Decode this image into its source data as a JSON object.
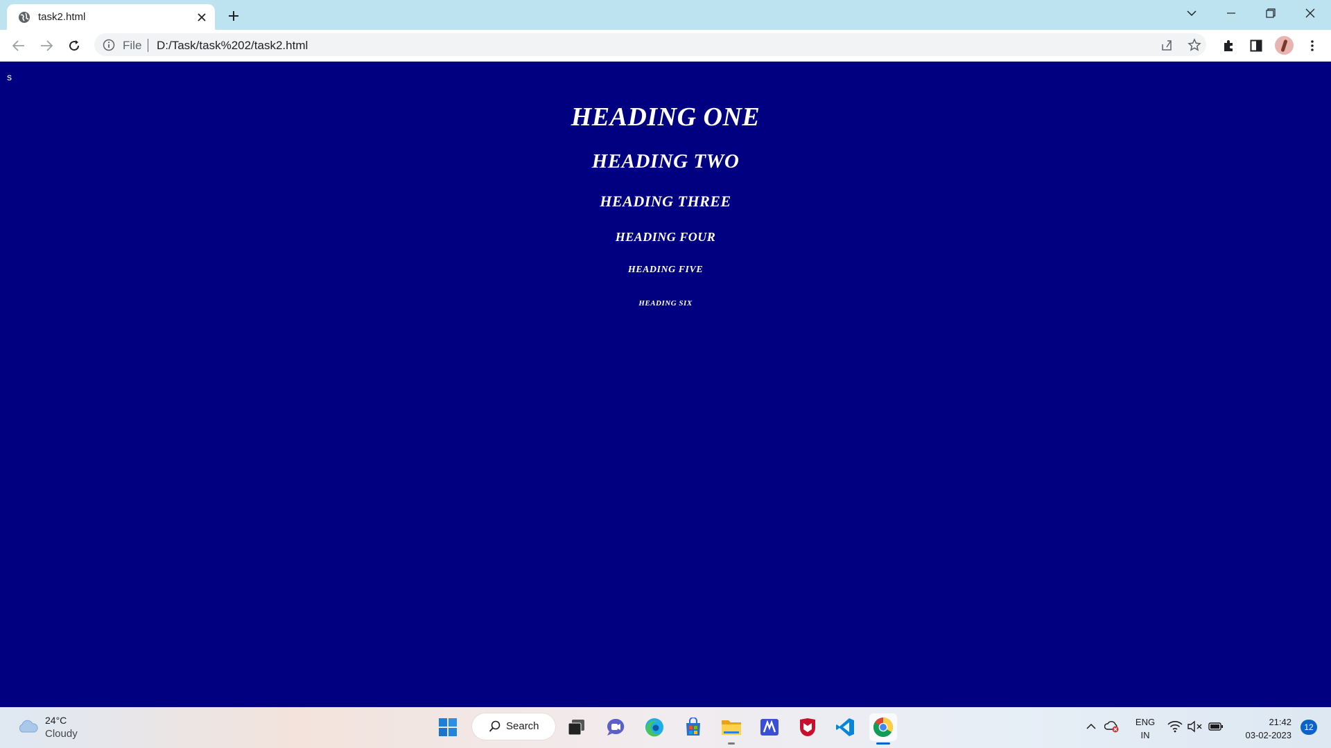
{
  "browser": {
    "tab_title": "task2.html",
    "scheme_label": "File",
    "url": "D:/Task/task%202/task2.html"
  },
  "page": {
    "stray_text": "s",
    "headings": {
      "h1": "HEADING ONE",
      "h2": "HEADING TWO",
      "h3": "HEADING THREE",
      "h4": "HEADING FOUR",
      "h5": "HEADING FIVE",
      "h6": "HEADING SIX"
    },
    "background_color": "#000080",
    "text_color": "#ffffff"
  },
  "taskbar": {
    "weather": {
      "temp": "24°C",
      "condition": "Cloudy",
      "icon": "cloud-icon"
    },
    "search_label": "Search",
    "apps": [
      "windows-start-icon",
      "search",
      "task-view-icon",
      "teams-chat-icon",
      "edge-icon",
      "store-icon",
      "file-explorer-icon",
      "mcafee-app-icon",
      "mcafee-shield-icon",
      "vscode-icon",
      "chrome-icon"
    ],
    "language": {
      "line1": "ENG",
      "line2": "IN"
    },
    "clock": {
      "time": "21:42",
      "date": "03-02-2023"
    },
    "notifications": "12"
  }
}
